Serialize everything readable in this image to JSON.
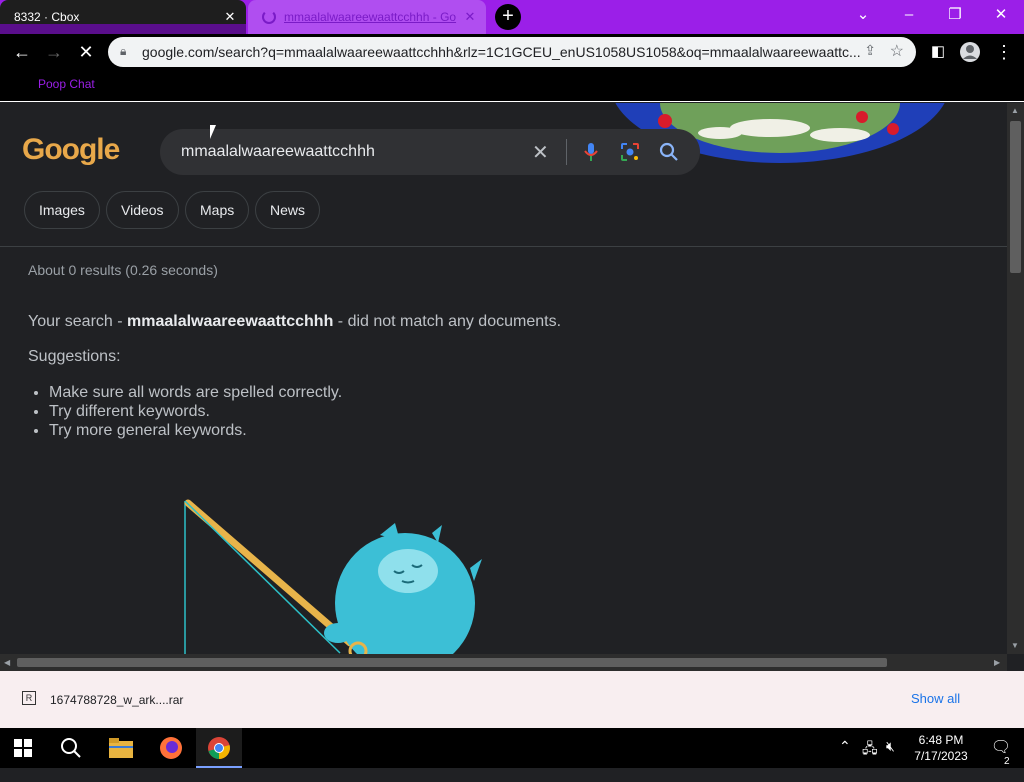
{
  "browser": {
    "tabs": [
      {
        "title": "8332 · Cbox",
        "active": false
      },
      {
        "title": "mmaalalwaareewaattcchhh - Go",
        "active": true,
        "loading": true
      }
    ],
    "address": "google.com/search?q=mmaalalwaareewaattcchhh&rlz=1C1GCEU_enUS1058US1058&oq=mmaalalwaareewaattc...",
    "bookmarks": [
      "Poop Chat"
    ]
  },
  "search": {
    "logo_text": "Google",
    "query": "mmaalalwaareewaattcchhh",
    "tabs": [
      "Images",
      "Videos",
      "Maps",
      "News"
    ],
    "stats": "About 0 results (0.26 seconds)",
    "no_match_prefix": "Your search - ",
    "no_match_term": "mmaalalwaareewaattcchhh",
    "no_match_suffix": " - did not match any documents.",
    "suggestions_heading": "Suggestions:",
    "suggestions": [
      "Make sure all words are spelled correctly.",
      "Try different keywords.",
      "Try more general keywords."
    ]
  },
  "downloads": {
    "file": "1674788728_w_ark....rar",
    "show_all": "Show all"
  },
  "taskbar": {
    "time": "6:48 PM",
    "date": "7/17/2023",
    "notifications": "2"
  },
  "colors": {
    "tabbar": "#9b1fe8",
    "page_bg": "#202124",
    "link": "#1a73e8"
  }
}
